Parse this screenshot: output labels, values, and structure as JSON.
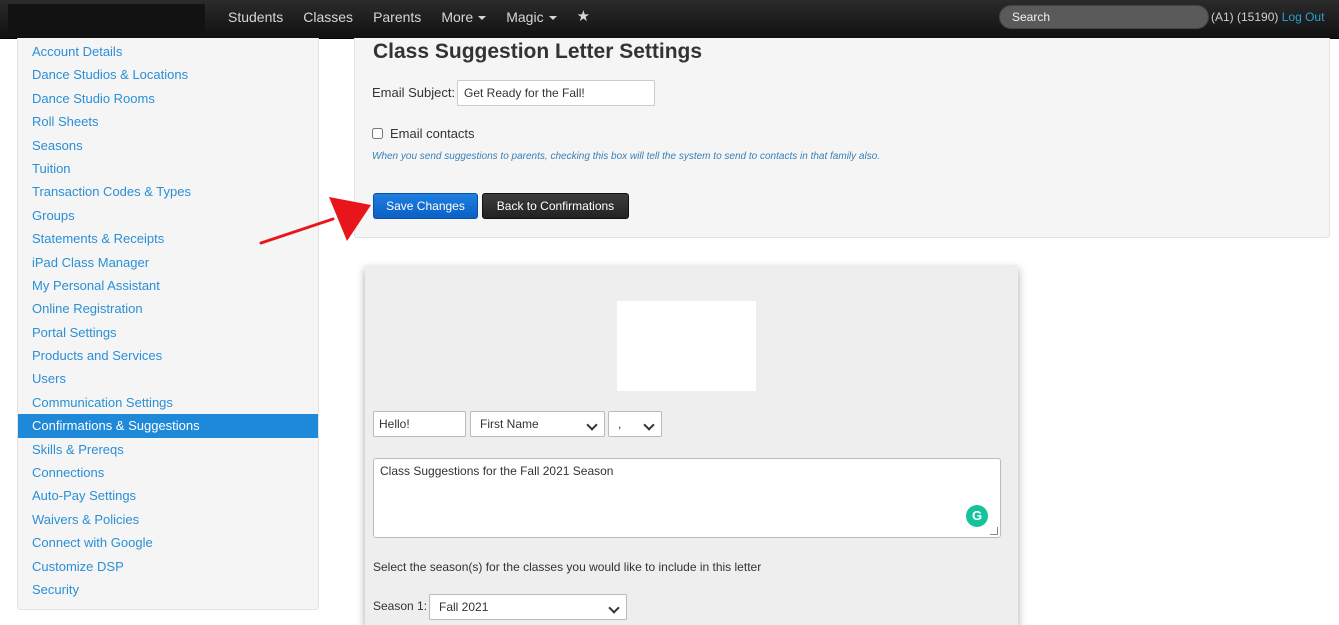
{
  "nav": {
    "items": [
      "Students",
      "Classes",
      "Parents",
      "More",
      "Magic"
    ],
    "star_icon": "★",
    "search_placeholder": "Search",
    "user_info": "(A1) (15190)",
    "logout_label": "Log Out"
  },
  "sidebar": {
    "items": [
      "Account Details",
      "Dance Studios & Locations",
      "Dance Studio Rooms",
      "Roll Sheets",
      "Seasons",
      "Tuition",
      "Transaction Codes & Types",
      "Groups",
      "Statements & Receipts",
      "iPad Class Manager",
      "My Personal Assistant",
      "Online Registration",
      "Portal Settings",
      "Products and Services",
      "Users",
      "Communication Settings",
      "Confirmations & Suggestions",
      "Skills & Prereqs",
      "Connections",
      "Auto-Pay Settings",
      "Waivers & Policies",
      "Connect with Google",
      "Customize DSP",
      "Security"
    ],
    "active_index": 16
  },
  "settings": {
    "title": "Class Suggestion Letter Settings",
    "email_subject_label": "Email Subject:",
    "email_subject_value": "Get Ready for the Fall!",
    "email_contacts_label": "Email contacts",
    "email_contacts_checked": false,
    "help_text": "When you send suggestions to parents, checking this box will tell the system to send to contacts in that family also.",
    "save_label": "Save Changes",
    "back_label": "Back to Confirmations"
  },
  "letter": {
    "greeting_value": "Hello!",
    "name_field_selected": "First Name",
    "punctuation_selected": ",",
    "body_text": "Class Suggestions for the Fall 2021 Season",
    "grammarly_icon": "G",
    "season_help": "Select the season(s) for the classes you would like to include in this letter",
    "season1_label": "Season 1:",
    "season1_selected": "Fall 2021"
  },
  "colors": {
    "primary_button": "#0b5fc4",
    "sidebar_active": "#1e88d9",
    "link": "#2a8fd6",
    "annotation_arrow": "#e8161b"
  }
}
